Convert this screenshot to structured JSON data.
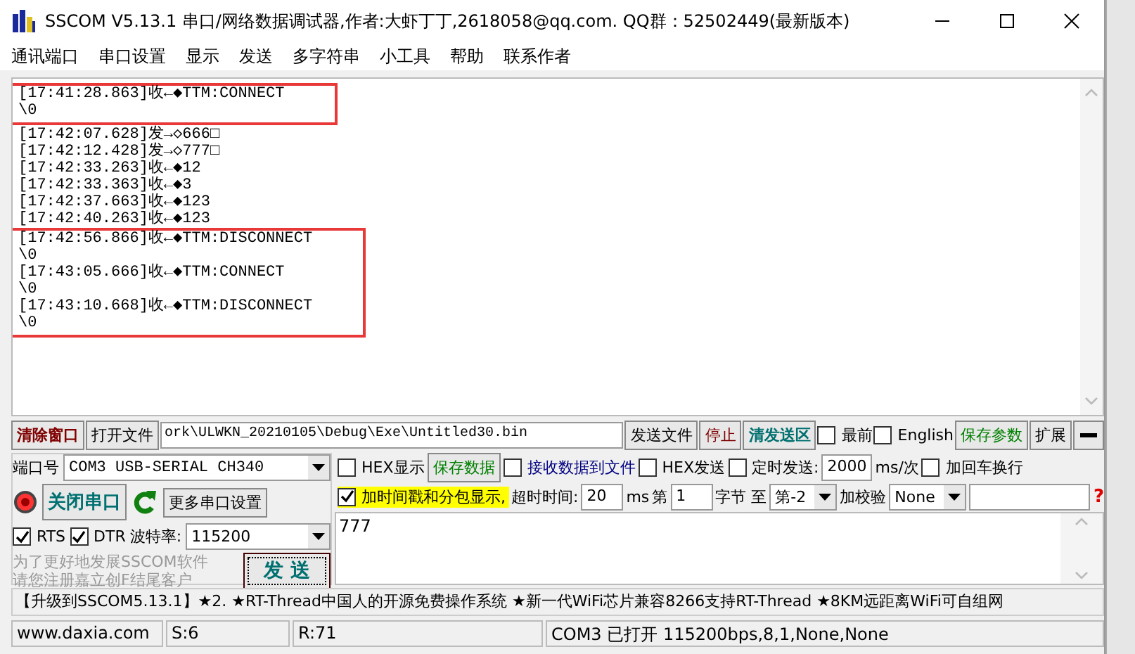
{
  "window": {
    "title": "SSCOM V5.13.1 串口/网络数据调试器,作者:大虾丁丁,2618058@qq.com. QQ群：52502449(最新版本)"
  },
  "menu": [
    "通讯端口",
    "串口设置",
    "显示",
    "发送",
    "多字符串",
    "小工具",
    "帮助",
    "联系作者"
  ],
  "log": {
    "blocks": [
      {
        "highlighted": true,
        "lines": [
          "[17:41:28.863]收←◆TTM:CONNECT",
          "\\0"
        ]
      },
      {
        "highlighted": false,
        "lines": [
          "[17:42:07.628]发→◇666□",
          "[17:42:12.428]发→◇777□",
          "[17:42:33.263]收←◆12",
          "[17:42:33.363]收←◆3",
          "[17:42:37.663]收←◆123",
          "[17:42:40.263]收←◆123"
        ]
      },
      {
        "highlighted": true,
        "lines": [
          "[17:42:56.866]收←◆TTM:DISCONNECT",
          "\\0",
          "[17:43:05.666]收←◆TTM:CONNECT",
          "\\0",
          "[17:43:10.668]收←◆TTM:DISCONNECT",
          "\\0"
        ]
      }
    ]
  },
  "toolbar": [
    {
      "kind": "button",
      "label": "清除窗口",
      "color": "#800000",
      "bold": true
    },
    {
      "kind": "button",
      "label": "打开文件",
      "color": "#000000",
      "bold": false
    },
    {
      "kind": "path",
      "value": "ork\\ULWKN_20210105\\Debug\\Exe\\Untitled30.bin"
    },
    {
      "kind": "button",
      "label": "发送文件",
      "color": "#000000",
      "bold": false
    },
    {
      "kind": "button",
      "label": "停止",
      "color": "#800000",
      "bold": false
    },
    {
      "kind": "button",
      "label": "清发送区",
      "color": "#007070",
      "bold": true
    },
    {
      "kind": "checkbox",
      "label": "最前",
      "checked": false
    },
    {
      "kind": "checkbox",
      "label": "English",
      "checked": false
    },
    {
      "kind": "button",
      "label": "保存参数",
      "color": "#008000",
      "bold": false
    },
    {
      "kind": "button",
      "label": "扩展",
      "color": "#000000",
      "bold": false
    },
    {
      "kind": "minbutton"
    }
  ],
  "port_panel": {
    "rows": [
      [
        {
          "kind": "label",
          "label": "端口号"
        },
        {
          "kind": "select",
          "value": "COM3 USB-SERIAL CH340"
        }
      ],
      [
        {
          "kind": "indicator"
        },
        {
          "kind": "button",
          "label": "关闭串口",
          "color": "#007070",
          "bold": true
        },
        {
          "kind": "refresh"
        },
        {
          "kind": "button",
          "label": "更多串口设置",
          "color": "#000000",
          "bold": false
        }
      ],
      [
        {
          "kind": "checkbox",
          "label": "RTS",
          "checked": true
        },
        {
          "kind": "checkbox",
          "label": "DTR",
          "checked": true
        },
        {
          "kind": "label",
          "label": "波特率:"
        },
        {
          "kind": "select",
          "value": "115200"
        }
      ]
    ],
    "notice": [
      "为了更好地发展SSCOM软件",
      "请您注册嘉立创F结尾客户"
    ],
    "send_button": "发  送"
  },
  "send_panel": {
    "upper_controls": [
      {
        "kind": "checkbox",
        "label": "HEX显示",
        "checked": false
      },
      {
        "kind": "button",
        "label": "保存数据",
        "color": "#008000",
        "bold": false
      },
      {
        "kind": "checkbox",
        "label": "接收数据到文件",
        "checked": false,
        "color": "#000080"
      },
      {
        "kind": "checkbox",
        "label": "HEX发送",
        "checked": false
      },
      {
        "kind": "checkbox",
        "label": "定时发送:",
        "checked": false
      },
      {
        "kind": "field",
        "value": "2000"
      },
      {
        "kind": "label",
        "label": "ms/次"
      },
      {
        "kind": "checkbox",
        "label": "加回车换行",
        "checked": false
      }
    ],
    "lower_controls": [
      {
        "kind": "checkbox",
        "label": "加时间戳和分包显示,",
        "checked": true,
        "highlighted": true
      },
      {
        "kind": "label",
        "label": "超时时间:"
      },
      {
        "kind": "field",
        "value": "20"
      },
      {
        "kind": "label",
        "label": "ms"
      },
      {
        "kind": "label",
        "label": "第"
      },
      {
        "kind": "field",
        "value": "1"
      },
      {
        "kind": "label",
        "label": "字节 至"
      },
      {
        "kind": "select",
        "value": "第-2"
      },
      {
        "kind": "label",
        "label": "加校验"
      },
      {
        "kind": "select",
        "value": "None"
      },
      {
        "kind": "blankfield"
      },
      {
        "kind": "help",
        "label": "?"
      }
    ],
    "input": {
      "value": "777"
    }
  },
  "ticker": "【升级到SSCOM5.13.1】★2. ★RT-Thread中国人的开源免费操作系统 ★新一代WiFi芯片兼容8266支持RT-Thread ★8KM远距离WiFi可自组网",
  "status_bar": [
    "www.daxia.com",
    "S:6",
    "R:71",
    "COM3 已打开  115200bps,8,1,None,None"
  ]
}
